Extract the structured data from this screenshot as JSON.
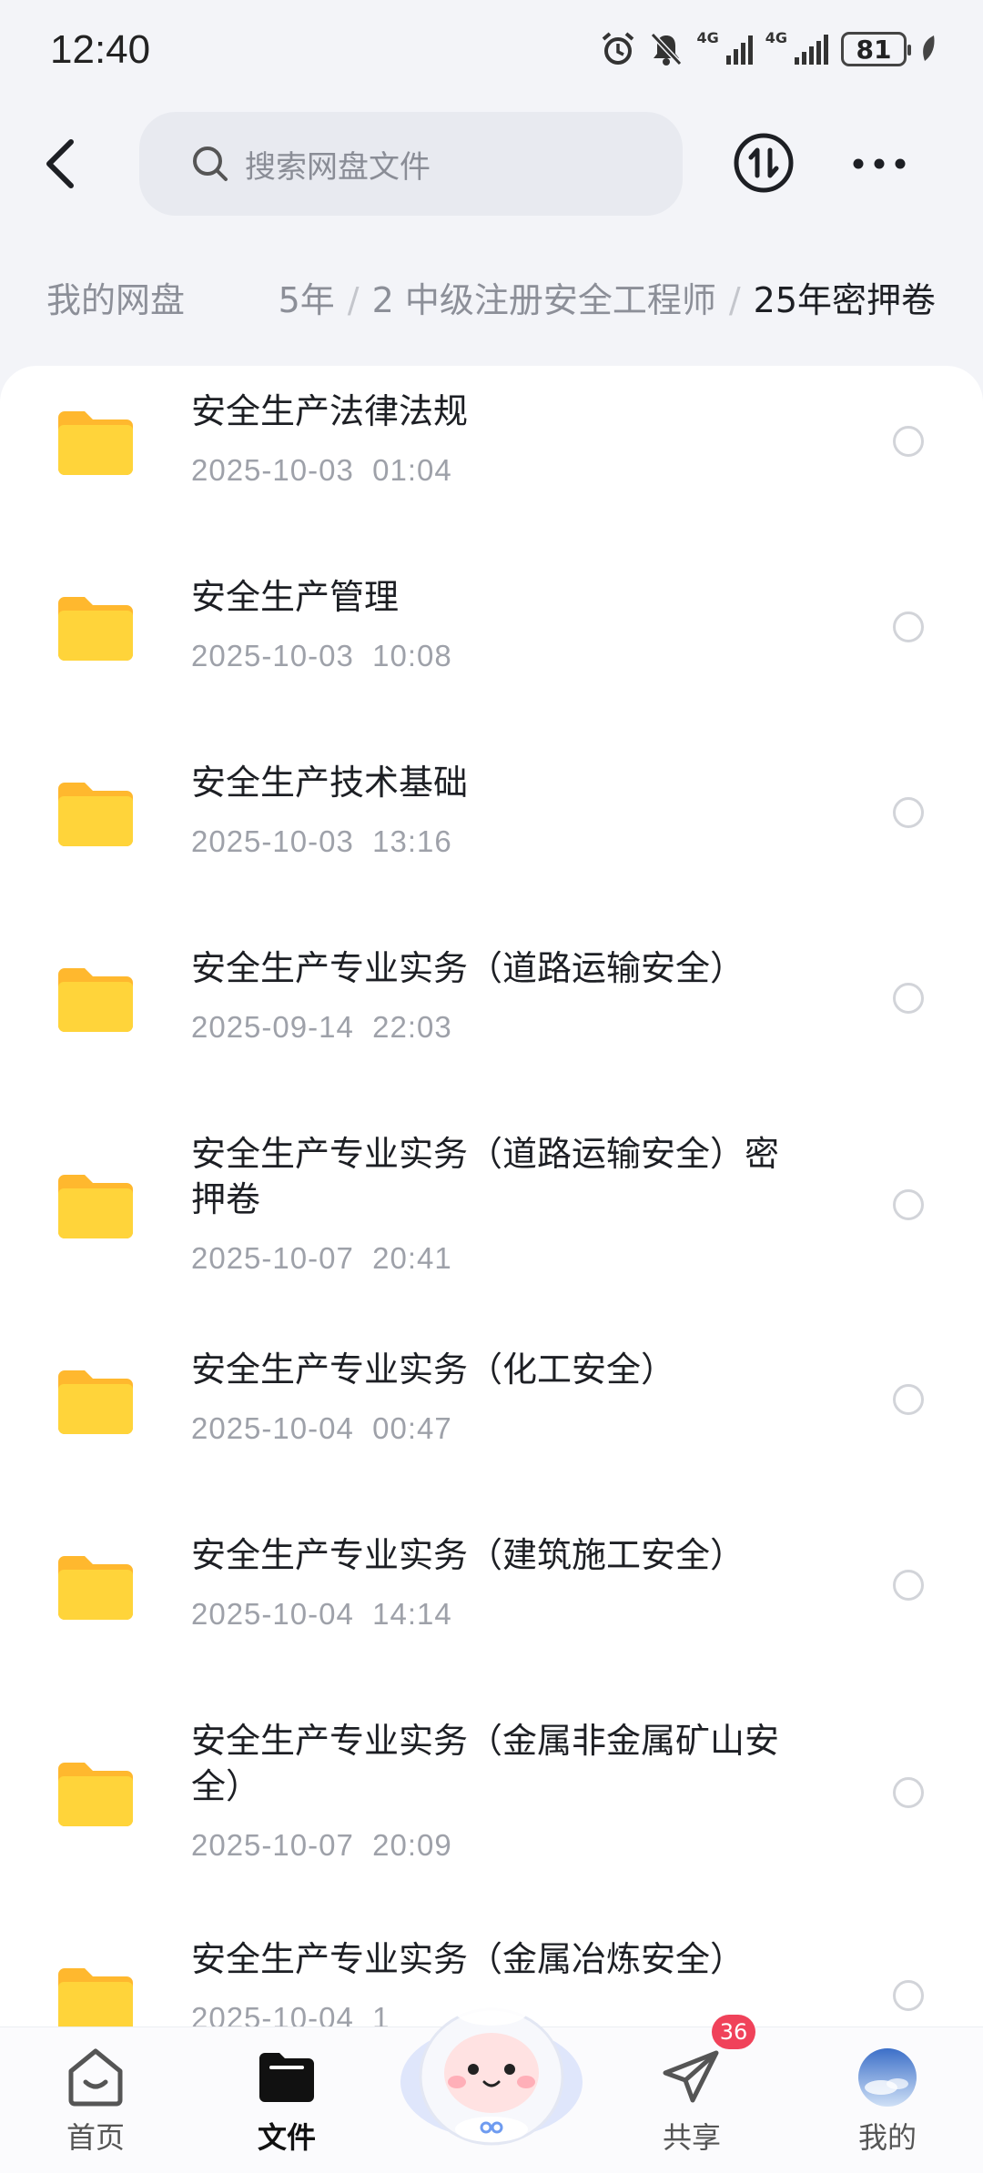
{
  "status": {
    "time": "12:40",
    "net1": "4G",
    "net2": "4G",
    "battery": "81"
  },
  "search": {
    "placeholder": "搜索网盘文件"
  },
  "breadcrumb": {
    "root": "我的网盘",
    "partial": "5年",
    "middle": "2 中级注册安全工程师",
    "current": "25年密押卷",
    "separator": "/"
  },
  "files": [
    {
      "name": "安全生产法律法规",
      "date": "2025-10-03",
      "time": "01:04"
    },
    {
      "name": "安全生产管理",
      "date": "2025-10-03",
      "time": "10:08"
    },
    {
      "name": "安全生产技术基础",
      "date": "2025-10-03",
      "time": "13:16"
    },
    {
      "name": "安全生产专业实务（道路运输安全）",
      "date": "2025-09-14",
      "time": "22:03"
    },
    {
      "name": "安全生产专业实务（道路运输安全）密押卷",
      "date": "2025-10-07",
      "time": "20:41"
    },
    {
      "name": "安全生产专业实务（化工安全）",
      "date": "2025-10-04",
      "time": "00:47"
    },
    {
      "name": "安全生产专业实务（建筑施工安全）",
      "date": "2025-10-04",
      "time": "14:14"
    },
    {
      "name": "安全生产专业实务（金属非金属矿山安全）",
      "date": "2025-10-07",
      "time": "20:09"
    },
    {
      "name": "安全生产专业实务（金属冶炼安全）",
      "date": "2025-10-04",
      "time": "1"
    }
  ],
  "nav": {
    "home": "首页",
    "files": "文件",
    "share": "共享",
    "share_badge": "36",
    "me": "我的"
  },
  "colors": {
    "folder": "#ffcf2e",
    "accent": "#1d1f24",
    "badge": "#f0425a"
  }
}
